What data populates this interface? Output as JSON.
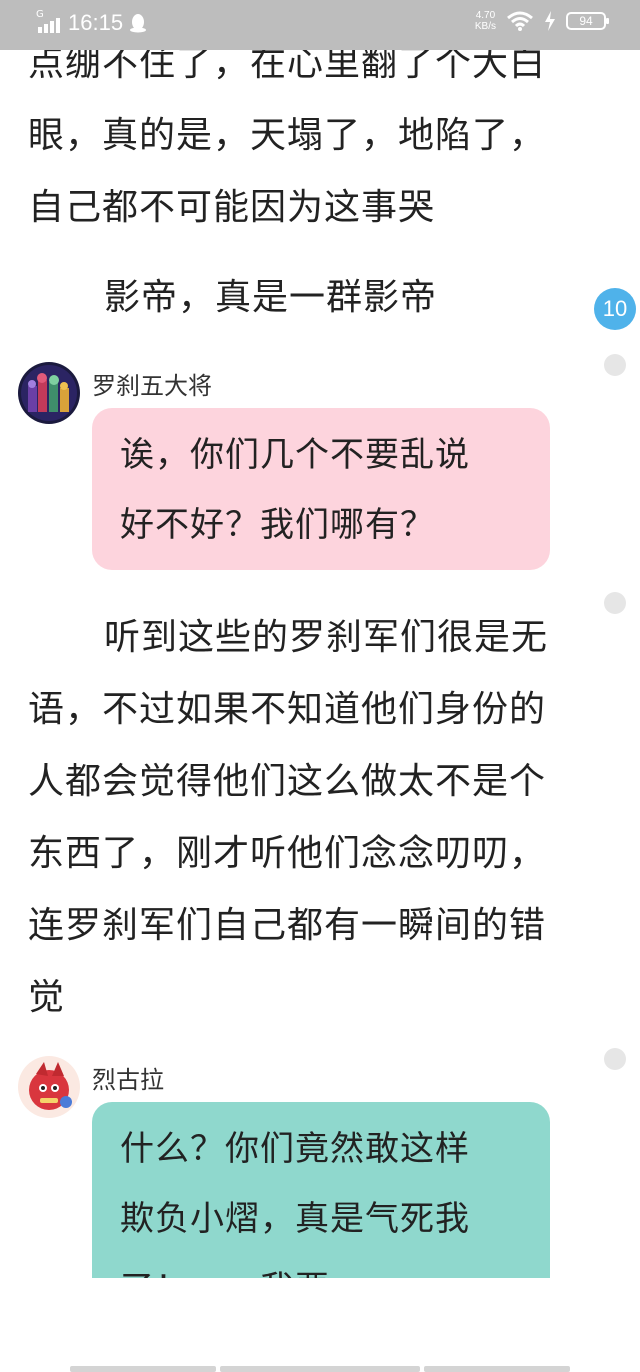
{
  "status_bar": {
    "network": "G",
    "time": "16:15",
    "speed_value": "4.70",
    "speed_unit": "KB/s",
    "battery": "94",
    "icons": [
      "signal-icon",
      "qq-icon",
      "wifi-icon",
      "charging-icon",
      "battery-icon"
    ]
  },
  "content": {
    "para_top_lines": [
      "点绷不住了，在心里翻了个大白",
      "眼，真的是，天塌了，地陷了，",
      "自己都不可能因为这事哭"
    ],
    "para_actor": "影帝，真是一群影帝",
    "comment_badge": "10",
    "dialog1": {
      "name": "罗刹五大将",
      "lines": [
        "诶，你们几个不要乱说",
        "好不好？我们哪有？"
      ],
      "bubble_color": "#fdd4dd"
    },
    "para_mid_lines": [
      "听到这些的罗刹军们很是无",
      "语，不过如果不知道他们身份的",
      "人都会觉得他们这么做太不是个",
      "东西了，刚才听他们念念叨叨，",
      "连罗刹军们自己都有一瞬间的错",
      "觉"
    ],
    "dialog2": {
      "name": "烈古拉",
      "lines": [
        "什么？你们竟然敢这样",
        "欺负小熠，真是气死我",
        "了！……我要……"
      ],
      "bubble_color": "#8fd8cd"
    }
  }
}
